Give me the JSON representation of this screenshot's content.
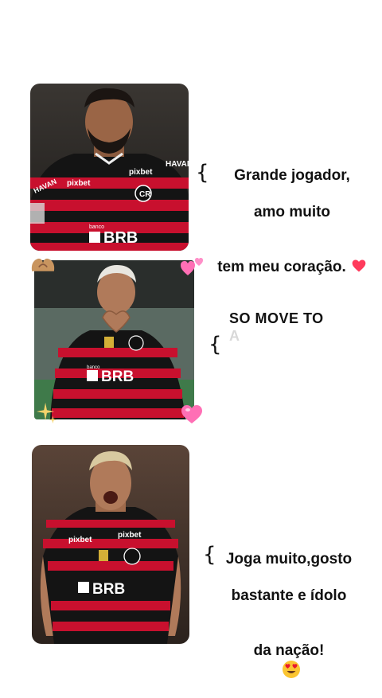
{
  "posts": [
    {
      "caption_line1": "Grande jogador,",
      "caption_line2": "amo muito",
      "caption_line3": "tem meu coração.",
      "emoji": "red-heart-icon",
      "sponsor_main": "BRB",
      "sponsor_small": "banco",
      "shirt_text_left": "pixbet",
      "shirt_text_right": "pixbet",
      "sleeve_text": "HAVAN",
      "sleeve_text2": "HAVAN"
    },
    {
      "caption_line1": "SO MOVE TO",
      "caption_line2": "A",
      "sponsor_main": "BRB",
      "sponsor_small": "banco"
    },
    {
      "caption_line1": "Joga muito,gosto",
      "caption_line2": "bastante e ídolo",
      "caption_line3": "da nação!",
      "emoji": "heart-eyes-emoji-icon",
      "sponsor_main": "BRB",
      "shirt_text_left": "pixbet",
      "shirt_text_right": "pixbet"
    }
  ],
  "colors": {
    "flamengo_red": "#c8102e",
    "flamengo_black": "#141414",
    "caption_text": "#111111",
    "faded_text": "#d8d8d8",
    "heart_pink": "#ff6fb5"
  }
}
